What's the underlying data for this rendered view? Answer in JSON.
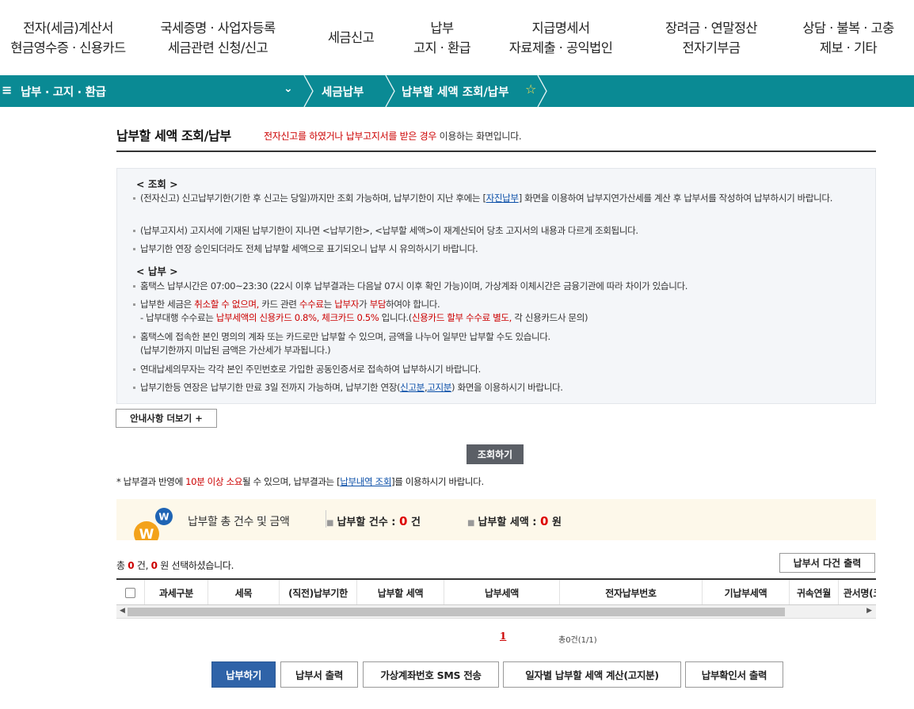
{
  "top_menu": [
    {
      "line1": "전자(세금)계산서",
      "line2": "현금영수증 · 신용카드"
    },
    {
      "line1": "국세증명 · 사업자등록",
      "line2": "세금관련 신청/신고"
    },
    {
      "line1": "세금신고",
      "line2": ""
    },
    {
      "line1": "납부",
      "line2": "고지 · 환급"
    },
    {
      "line1": "지급명세서",
      "line2": "자료제출 · 공익법인"
    },
    {
      "line1": "장려금 · 연말정산",
      "line2": "전자기부금"
    },
    {
      "line1": "상담 · 불복 · 고충",
      "line2": "제보 · 기타"
    }
  ],
  "nav": {
    "menu_glyph": "≡",
    "section": "납부 · 고지 · 환급",
    "caret": "⌄",
    "crumb1": "세금납부",
    "crumb2": "납부할 세액 조회/납부",
    "star": "☆"
  },
  "page": {
    "title": "납부할 세액 조회/납부",
    "subtitle_red": "전자신고를 하였거나 납부고지서를 받은 경우",
    "subtitle_rest": " 이용하는 화면입니다."
  },
  "info": {
    "head_inquiry": "< 조회 >",
    "q1_a": "(전자신고) 신고납부기한(기한 후 신고는 당일)까지만 조회 가능하며, 납부기한이 지난 후에는 [",
    "q1_link": "자진납부",
    "q1_b": "] 화면을 이용하여 납부지연가산세를 계산 후 납부서를 작성하여 납부하시기 바랍니다.",
    "q2": "(납부고지서) 고지서에 기재된 납부기한이 지나면 <납부기한>, <납부할 세액>이 재계산되어 당초 고지서의 내용과 다르게 조회됩니다.",
    "q3": "납부기한 연장 승인되더라도 전체 납부할 세액으로 표기되오니 납부 시 유의하시기 바랍니다.",
    "head_payment": "< 납부 >",
    "p1": "홈택스 납부시간은 07:00~23:30 (22시 이후 납부결과는 다음날 07시 이후 확인 가능)이며, 가상계좌 이체시간은 금융기관에 따라 차이가 있습니다.",
    "p2_a": "납부한 세금은 ",
    "p2_red1": "취소할 수 없으며,",
    "p2_b": " 카드 관련 ",
    "p2_red2": "수수료",
    "p2_c": "는 ",
    "p2_red3": "납부자",
    "p2_d": "가 ",
    "p2_red4": "부담",
    "p2_e": "하여야 합니다.",
    "p2_sub_a": "- 납부대행 수수료는 ",
    "p2_sub_red1": "납부세액의 신용카드 0.8%, 체크카드 0.5%",
    "p2_sub_b": " 입니다.(",
    "p2_sub_red2": "신용카드 할부 수수료 별도,",
    "p2_sub_c": " 각 신용카드사 문의)",
    "p3_a": "홈택스에 접속한 본인 명의의 계좌 또는 카드로만 납부할 수 있으며, 금액을 나누어 일부만 납부할 수도 있습니다.",
    "p3_b": "(납부기한까지 미납된 금액은 가산세가 부과됩니다.)",
    "p4": "연대납세의무자는 각각 본인 주민번호로 가입한 공동인증서로 접속하여 납부하시기 바랍니다.",
    "p5_a": "납부기한등 연장은 납부기한 만료 3일 전까지 가능하며, 납부기한 연장(",
    "p5_link1": "신고분",
    "p5_comma": ",",
    "p5_link2": "고지분",
    "p5_b": ") 화면을 이용하시기 바랍니다."
  },
  "more_button": "안내사항 더보기 +",
  "search_button": "조회하기",
  "notice": {
    "a": "* 납부결과 반영에 ",
    "red": "10분 이상 소요",
    "b": "될 수 있으며, 납부결과는 [",
    "link": "납부내역 조회",
    "c": "]를 이용하시기 바랍니다."
  },
  "summary": {
    "label": "납부할 총 건수 및 금액",
    "count_label": "납부할 건수 : ",
    "count_value": "0",
    "count_unit": " 건",
    "amount_label": "납부할 세액 : ",
    "amount_value": "0",
    "amount_unit": " 원"
  },
  "selection": {
    "a": "총 ",
    "count": "0",
    "b": " 건, ",
    "amount": "0",
    "c": " 원 선택하셨습니다."
  },
  "print_multi_button": "납부서 다건 출력",
  "table_headers": [
    "과세구분",
    "세목",
    "(직전)납부기한",
    "납부할 세액",
    "납부세액",
    "전자납부번호",
    "기납부세액",
    "귀속연월",
    "관서명(코"
  ],
  "pager": {
    "page": "1",
    "count": "총0건(1/1)"
  },
  "bottom_buttons": [
    "납부하기",
    "납부서 출력",
    "가상계좌번호 SMS 전송",
    "일자별 납부할 세액 계산(고지분)",
    "납부확인서 출력"
  ]
}
